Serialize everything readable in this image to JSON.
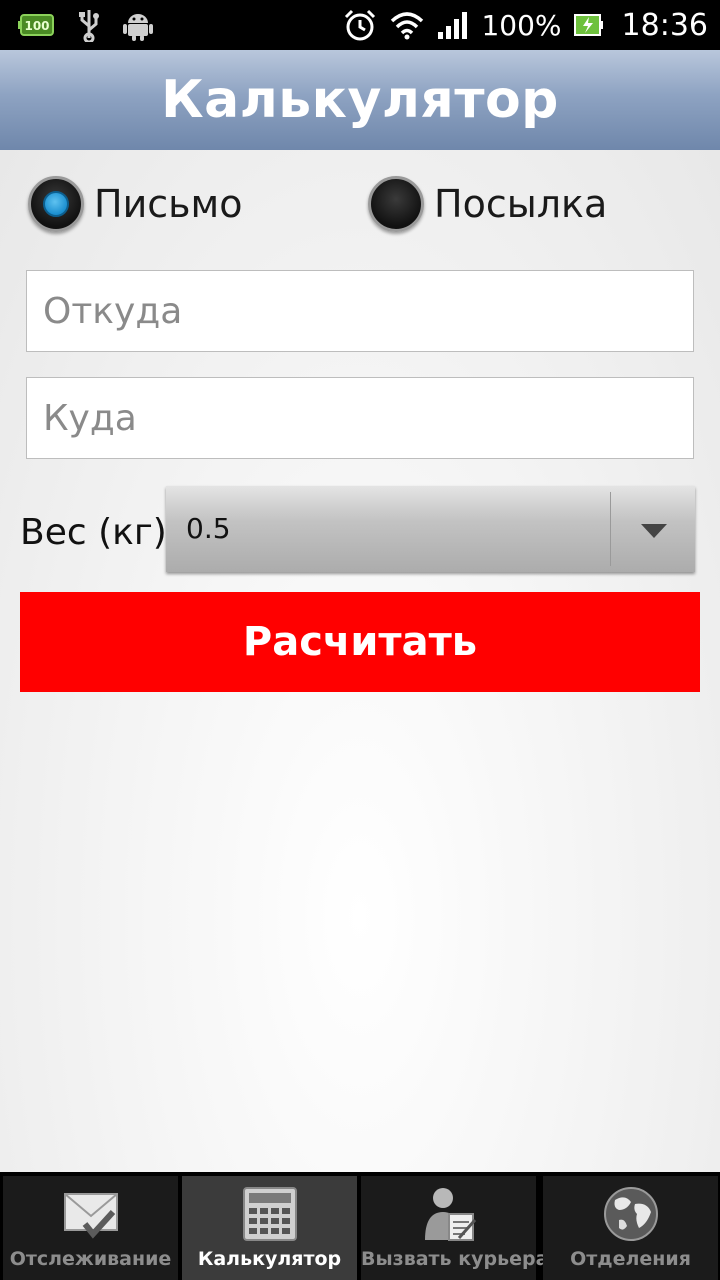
{
  "status_bar": {
    "battery_badge": "100",
    "battery_percent": "100%",
    "time": "18:36"
  },
  "header": {
    "title": "Калькулятор"
  },
  "form": {
    "radio_options": [
      {
        "label": "Письмо",
        "selected": true
      },
      {
        "label": "Посылка",
        "selected": false
      }
    ],
    "from_placeholder": "Откуда",
    "to_placeholder": "Куда",
    "weight_label": "Вес (кг)",
    "weight_value": "0.5",
    "calculate_label": "Расчитать"
  },
  "tabs": [
    {
      "label": "Отслеживание",
      "icon": "envelope-check-icon",
      "active": false
    },
    {
      "label": "Калькулятор",
      "icon": "calculator-icon",
      "active": true
    },
    {
      "label": "Вызвать курьера",
      "icon": "courier-icon",
      "active": false
    },
    {
      "label": "Отделения",
      "icon": "globe-icon",
      "active": false
    }
  ],
  "colors": {
    "accent": "#ff0000",
    "radio_selected": "#1b8fd0",
    "title_bar": "#8ea3c2"
  }
}
